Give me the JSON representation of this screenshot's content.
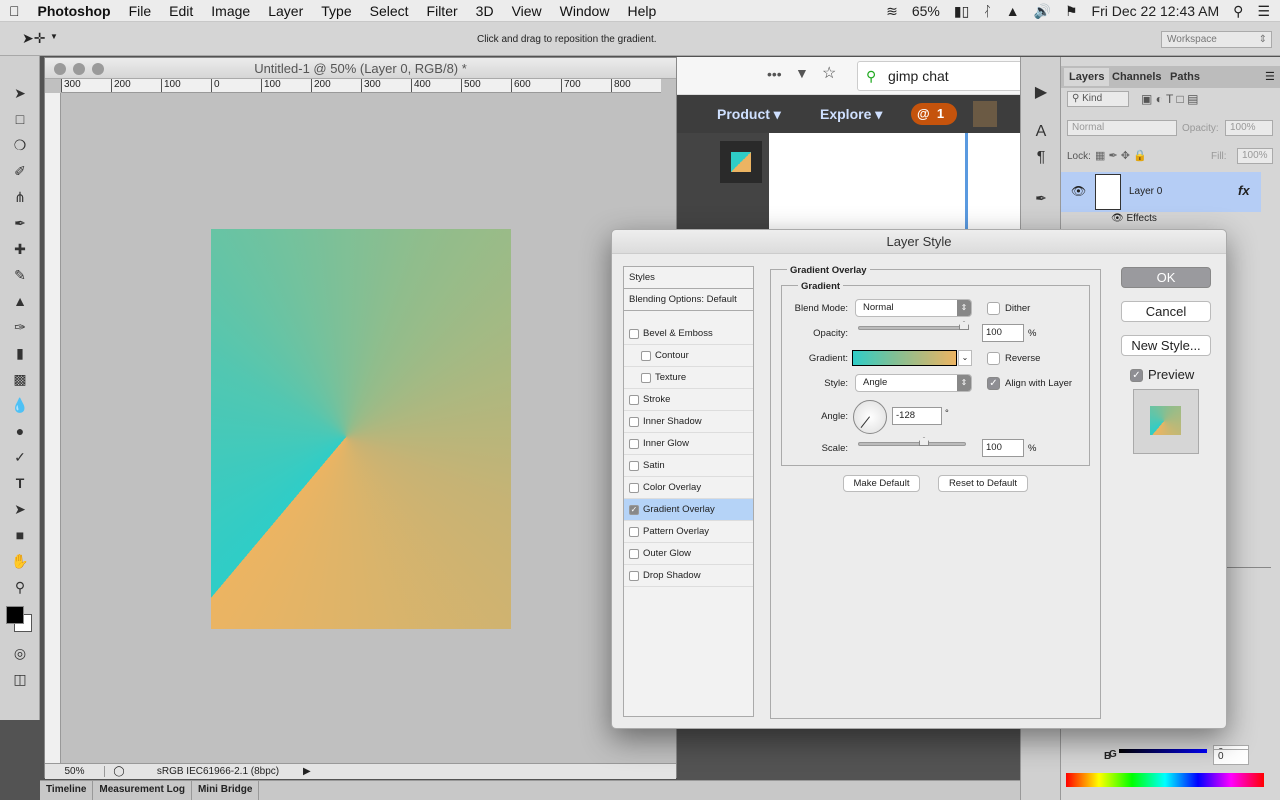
{
  "menubar": {
    "app": "Photoshop",
    "items": [
      "File",
      "Edit",
      "Image",
      "Layer",
      "Type",
      "Select",
      "Filter",
      "3D",
      "View",
      "Window",
      "Help"
    ],
    "battery": "65%",
    "datetime": "Fri Dec 22  12:43 AM"
  },
  "options": {
    "hint": "Click and drag to reposition the gradient.",
    "workspace": "Workspace"
  },
  "document": {
    "title": "Untitled-1 @ 50% (Layer 0, RGB/8) *",
    "ruler_labels": [
      "300",
      "200",
      "100",
      "0",
      "100",
      "200",
      "300",
      "400",
      "500",
      "600",
      "700",
      "800"
    ],
    "zoom": "50%",
    "profile": "sRGB IEC61966-2.1 (8bpc)",
    "gradient_colors": [
      "#2fcdc7",
      "#ecb462"
    ]
  },
  "browser": {
    "search": "gimp chat",
    "nav": [
      "Product",
      "Explore"
    ],
    "notif_count": "1",
    "at_symbol": "@"
  },
  "layers_panel": {
    "tabs": [
      "Layers",
      "Channels",
      "Paths"
    ],
    "kind": "Kind",
    "blend": "Normal",
    "opacity_label": "Opacity:",
    "opacity": "100%",
    "lock_label": "Lock:",
    "fill_label": "Fill:",
    "fill": "100%",
    "layer_name": "Layer 0",
    "fx": "fx",
    "effects": "Effects"
  },
  "color_panel": {
    "g_label": "G",
    "g": "0",
    "b_label": "B",
    "b": "0"
  },
  "bottom_tabs": [
    "Timeline",
    "Measurement Log",
    "Mini Bridge"
  ],
  "dialog": {
    "title": "Layer Style",
    "styles": [
      {
        "label": "Styles",
        "checkbox": false,
        "checked": false
      },
      {
        "label": "Blending Options: Default",
        "checkbox": false,
        "checked": false
      },
      {
        "label": "Bevel & Emboss",
        "checkbox": true,
        "checked": false
      },
      {
        "label": "Contour",
        "checkbox": true,
        "checked": false,
        "indent": true
      },
      {
        "label": "Texture",
        "checkbox": true,
        "checked": false,
        "indent": true
      },
      {
        "label": "Stroke",
        "checkbox": true,
        "checked": false
      },
      {
        "label": "Inner Shadow",
        "checkbox": true,
        "checked": false
      },
      {
        "label": "Inner Glow",
        "checkbox": true,
        "checked": false
      },
      {
        "label": "Satin",
        "checkbox": true,
        "checked": false
      },
      {
        "label": "Color Overlay",
        "checkbox": true,
        "checked": false
      },
      {
        "label": "Gradient Overlay",
        "checkbox": true,
        "checked": true,
        "selected": true
      },
      {
        "label": "Pattern Overlay",
        "checkbox": true,
        "checked": false
      },
      {
        "label": "Outer Glow",
        "checkbox": true,
        "checked": false
      },
      {
        "label": "Drop Shadow",
        "checkbox": true,
        "checked": false
      }
    ],
    "section": "Gradient Overlay",
    "group": "Gradient",
    "blend_label": "Blend Mode:",
    "blend": "Normal",
    "dither": "Dither",
    "dither_checked": false,
    "opacity_label": "Opacity:",
    "opacity": "100",
    "opacity_fraction": 1.0,
    "pct": "%",
    "gradient_label": "Gradient:",
    "reverse": "Reverse",
    "reverse_checked": false,
    "style_label": "Style:",
    "style": "Angle",
    "align": "Align with Layer",
    "align_checked": true,
    "angle_label": "Angle:",
    "angle": "-128",
    "degree": "°",
    "scale_label": "Scale:",
    "scale": "100",
    "scale_fraction": 0.5,
    "make_default": "Make Default",
    "reset_default": "Reset to Default",
    "ok": "OK",
    "cancel": "Cancel",
    "new_style": "New Style...",
    "preview": "Preview",
    "preview_checked": true
  }
}
